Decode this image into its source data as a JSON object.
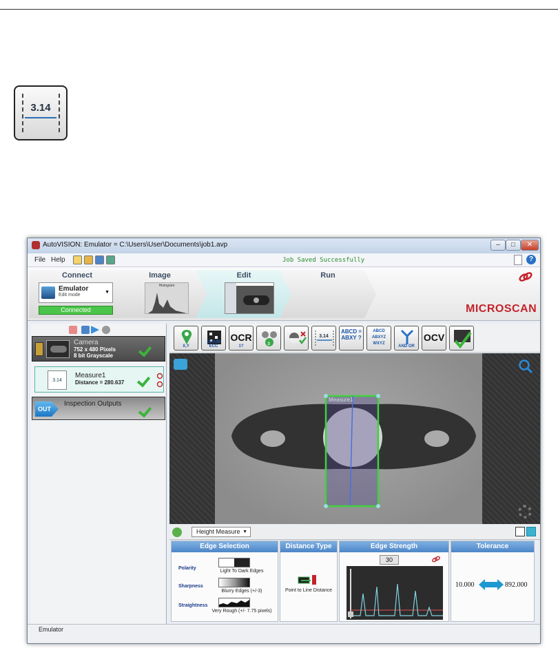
{
  "tool_icon": {
    "value": "3.14"
  },
  "window": {
    "title": "AutoVISION: Emulator  =  C:\\Users\\User\\Documents\\job1.avp",
    "controls": {
      "min": "–",
      "max": "□",
      "close": "✕"
    }
  },
  "menu": {
    "file": "File",
    "help": "Help",
    "status": "Job Saved Successfully",
    "help_icon": "?"
  },
  "steps": {
    "connect": "Connect",
    "image": "Image",
    "edit": "Edit",
    "run": "Run",
    "emulator_name": "Emulator",
    "emulator_mode": "Edit mode",
    "connected": "Connected",
    "histogram_label": "Histogram"
  },
  "brand": {
    "logo": "MICROSCAN",
    "accent": "#c4232b"
  },
  "left_panel": {
    "camera": {
      "title": "Camera",
      "line1": "752 x 480 Pixels",
      "line2": "8 bit Grayscale"
    },
    "measure": {
      "title": "Measure1",
      "line1": "Distance = 280.637",
      "icon_text": "3.14"
    },
    "outputs": {
      "title": "Inspection Outputs",
      "badge": "OUT"
    }
  },
  "toolbar": {
    "tools": [
      {
        "name": "locate-tool",
        "glyph": "",
        "sub": "X,Y"
      },
      {
        "name": "barcode-tool",
        "glyph": "",
        "sub": "1D/AIM ECC"
      },
      {
        "name": "ocr-tool",
        "glyph": "OCR",
        "sub": "1?"
      },
      {
        "name": "count-tool",
        "glyph": "",
        "sub": "3"
      },
      {
        "name": "presence-tool",
        "glyph": "",
        "sub": ""
      },
      {
        "name": "measure-tool",
        "glyph": "",
        "sub": "3.14"
      },
      {
        "name": "match-string-tool",
        "glyph": "",
        "sub": "ABCD = ABXY ?"
      },
      {
        "name": "sort-string-tool",
        "glyph": "",
        "sub": "ABCD ABXYZ WXYZ"
      },
      {
        "name": "logic-tool",
        "glyph": "",
        "sub": "AND OR"
      },
      {
        "name": "ocv-tool",
        "glyph": "OCV",
        "sub": ""
      },
      {
        "name": "verify-tool",
        "glyph": "",
        "sub": ""
      }
    ]
  },
  "image_view": {
    "roi_label": "Measure1"
  },
  "properties": {
    "mode": "Height Measure",
    "edge_selection": {
      "header": "Edge Selection",
      "polarity_label": "Polarity",
      "polarity_value": "Light To Dark Edges",
      "sharpness_label": "Sharpness",
      "sharpness_value": "Blurry Edges (+/-3)",
      "straightness_label": "Straightness",
      "straightness_value": "Very Rough (+/- 7.75 pixels)"
    },
    "distance_type": {
      "header": "Distance Type",
      "value": "Point to Line Distance"
    },
    "edge_strength": {
      "header": "Edge Strength",
      "value": "30"
    },
    "tolerance": {
      "header": "Tolerance",
      "min": "10.000",
      "max": "892.000"
    }
  },
  "status_bar": {
    "text": "Emulator"
  }
}
